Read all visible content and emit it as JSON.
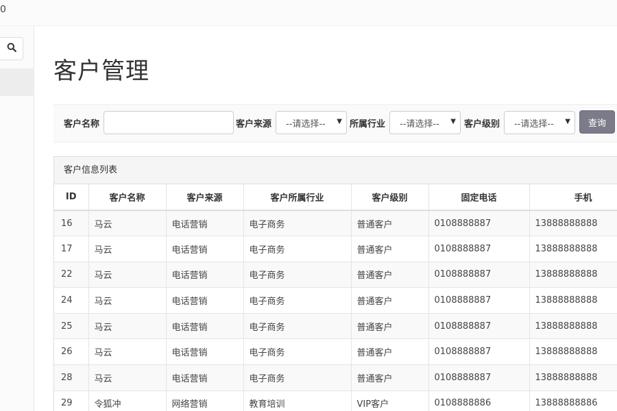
{
  "topbar": {
    "text": "0"
  },
  "sidebar": {
    "search_icon": "search-icon"
  },
  "page": {
    "title": "客户管理"
  },
  "filters": {
    "name_label": "客户名称",
    "name_value": "",
    "source_label": "客户来源",
    "source_selected": "--请选择--",
    "industry_label": "所属行业",
    "industry_selected": "--请选择--",
    "level_label": "客户级别",
    "level_selected": "--请选择--",
    "query_button": "查询"
  },
  "list": {
    "heading": "客户信息列表",
    "columns": [
      "ID",
      "客户名称",
      "客户来源",
      "客户所属行业",
      "客户级别",
      "固定电话",
      "手机"
    ],
    "rows": [
      [
        "16",
        "马云",
        "电话营销",
        "电子商务",
        "普通客户",
        "0108888887",
        "13888888888"
      ],
      [
        "17",
        "马云",
        "电话营销",
        "电子商务",
        "普通客户",
        "0108888887",
        "13888888888"
      ],
      [
        "22",
        "马云",
        "电话营销",
        "电子商务",
        "普通客户",
        "0108888887",
        "13888888888"
      ],
      [
        "24",
        "马云",
        "电话营销",
        "电子商务",
        "普通客户",
        "0108888887",
        "13888888888"
      ],
      [
        "25",
        "马云",
        "电话营销",
        "电子商务",
        "普通客户",
        "0108888887",
        "13888888888"
      ],
      [
        "26",
        "马云",
        "电话营销",
        "电子商务",
        "普通客户",
        "0108888887",
        "13888888888"
      ],
      [
        "28",
        "马云",
        "电话营销",
        "电子商务",
        "普通客户",
        "0108888887",
        "13888888888"
      ],
      [
        "29",
        "令狐冲",
        "网络营销",
        "教育培训",
        "VIP客户",
        "0108888886",
        "13888888886"
      ]
    ]
  }
}
